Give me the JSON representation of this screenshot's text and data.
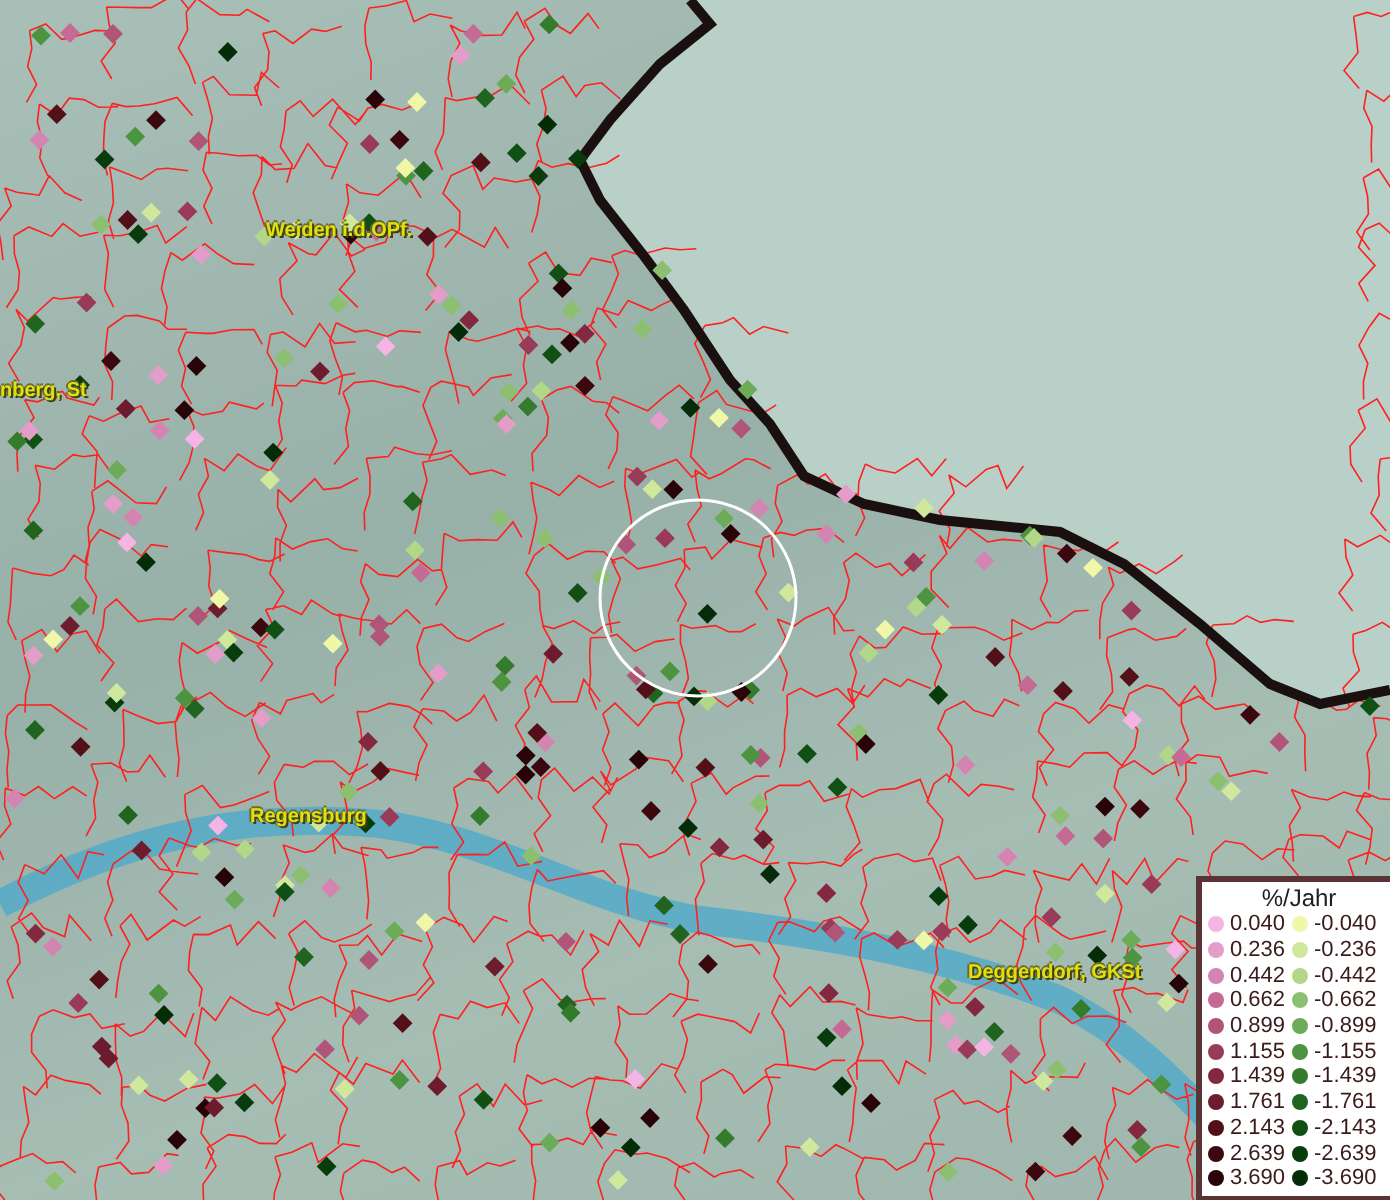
{
  "map": {
    "places": [
      {
        "name": "Weiden i.d.OPf."
      },
      {
        "name": "nberg, St"
      },
      {
        "name": "Regensburg"
      },
      {
        "name": "Deggendorf, GKSt"
      }
    ]
  },
  "legend": {
    "title": "%/Jahr",
    "columns": [
      {
        "items": [
          {
            "value": "0.040",
            "color": "#f4b4e4"
          },
          {
            "value": "0.236",
            "color": "#e49cc8"
          },
          {
            "value": "0.442",
            "color": "#d484b0"
          },
          {
            "value": "0.662",
            "color": "#c46a94"
          },
          {
            "value": "0.899",
            "color": "#b05478"
          },
          {
            "value": "1.155",
            "color": "#983a58"
          },
          {
            "value": "1.439",
            "color": "#842840"
          },
          {
            "value": "1.761",
            "color": "#6c1c2c"
          },
          {
            "value": "2.143",
            "color": "#541018"
          },
          {
            "value": "2.639",
            "color": "#3c0810"
          },
          {
            "value": "3.690",
            "color": "#280408"
          }
        ]
      },
      {
        "items": [
          {
            "value": "-0.040",
            "color": "#f0f8a8"
          },
          {
            "value": "-0.236",
            "color": "#d0e89c"
          },
          {
            "value": "-0.442",
            "color": "#b0d888"
          },
          {
            "value": "-0.662",
            "color": "#8cc070"
          },
          {
            "value": "-0.899",
            "color": "#6cac58"
          },
          {
            "value": "-1.155",
            "color": "#4c9440"
          },
          {
            "value": "-1.439",
            "color": "#347c2c"
          },
          {
            "value": "-1.761",
            "color": "#206420"
          },
          {
            "value": "-2.143",
            "color": "#105014"
          },
          {
            "value": "-2.639",
            "color": "#083c0c"
          },
          {
            "value": "-3.690",
            "color": "#042c08"
          }
        ]
      }
    ]
  }
}
